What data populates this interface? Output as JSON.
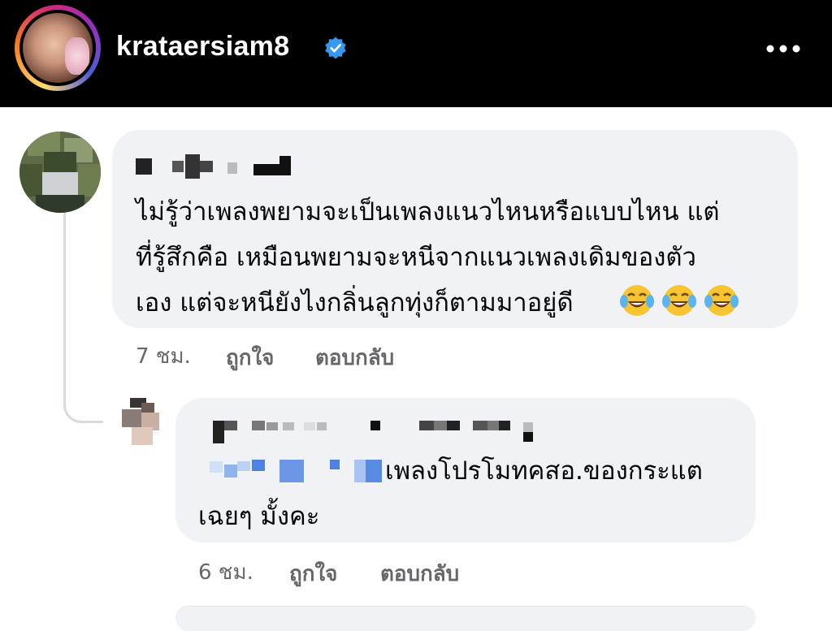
{
  "header": {
    "username": "krataersiam8",
    "verified_icon": "verified-badge-icon",
    "more_icon": "more-dots-icon",
    "accent_color": "#3897f0"
  },
  "comments": [
    {
      "text_lines": [
        "ไม่รู้ว่าเพลงพยามจะเป็นเพลงแนวไหนหรือแบบไหน แต่",
        "ที่รู้สึกคือ เหมือนพยามจะหนีจากแนวเพลงเดิมของตัว",
        "เอง แต่จะหนียังไงกลิ่นลูกทุ่งก็ตามมาอยู่ดี"
      ],
      "emoji": [
        "😂",
        "😂",
        "😂"
      ],
      "time": "7 ชม.",
      "like_label": "ถูกใจ",
      "reply_label": "ตอบกลับ"
    },
    {
      "text_lines": [
        "เพลงโปรโมทคสอ.ของกระแต",
        "เฉยๆ มั้งคะ"
      ],
      "time": "6 ชม.",
      "like_label": "ถูกใจ",
      "reply_label": "ตอบกลับ"
    }
  ]
}
